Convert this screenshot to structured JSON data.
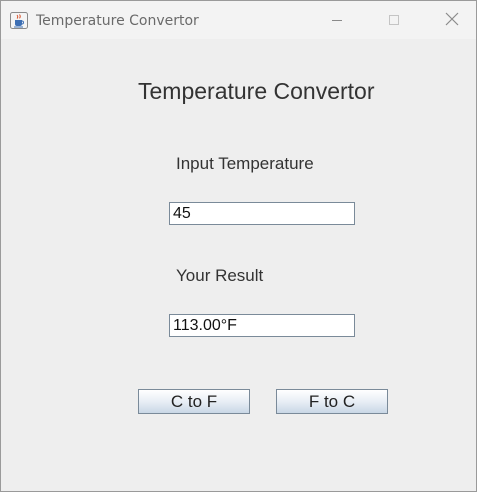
{
  "window": {
    "title": "Temperature Convertor"
  },
  "main": {
    "heading": "Temperature Convertor",
    "input_label": "Input Temperature",
    "input_value": "45",
    "result_label": "Your Result",
    "result_value": "113.00°F",
    "buttons": {
      "c_to_f": "C to F",
      "f_to_c": "F to C"
    }
  },
  "icons": {
    "app": "java-cup-icon",
    "minimize": "minimize-icon",
    "maximize": "maximize-icon",
    "close": "close-icon"
  },
  "colors": {
    "background": "#eeeeee",
    "titlebar": "#f3f3f3",
    "button_gradient_bottom": "#c9d7e6",
    "field_border": "#7a8a99"
  }
}
